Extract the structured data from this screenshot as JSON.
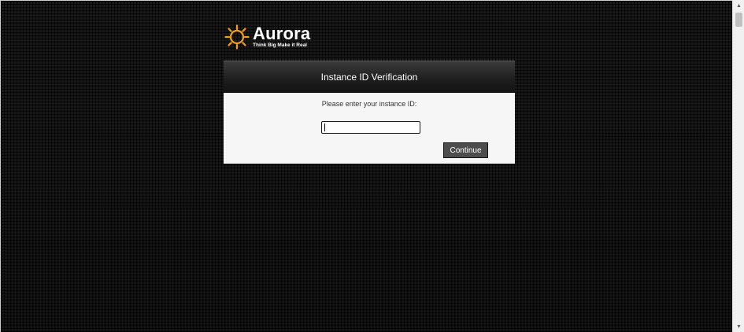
{
  "logo": {
    "name": "Aurora",
    "tagline": "Think Big Make it Real",
    "icon": "sun-icon",
    "colors": {
      "sun": "#f0a020",
      "text": "#ffffff"
    }
  },
  "panel": {
    "title": "Instance ID Verification",
    "prompt": "Please enter your instance ID:",
    "instance_input": {
      "value": "",
      "placeholder": ""
    },
    "continue_label": "Continue"
  },
  "colors": {
    "background": "#151515",
    "panel_body": "#f6f6f6",
    "button": "#4d4d4d"
  },
  "scrollbar": {
    "up_icon": "scroll-up-arrow-icon",
    "down_icon": "scroll-down-arrow-icon"
  }
}
